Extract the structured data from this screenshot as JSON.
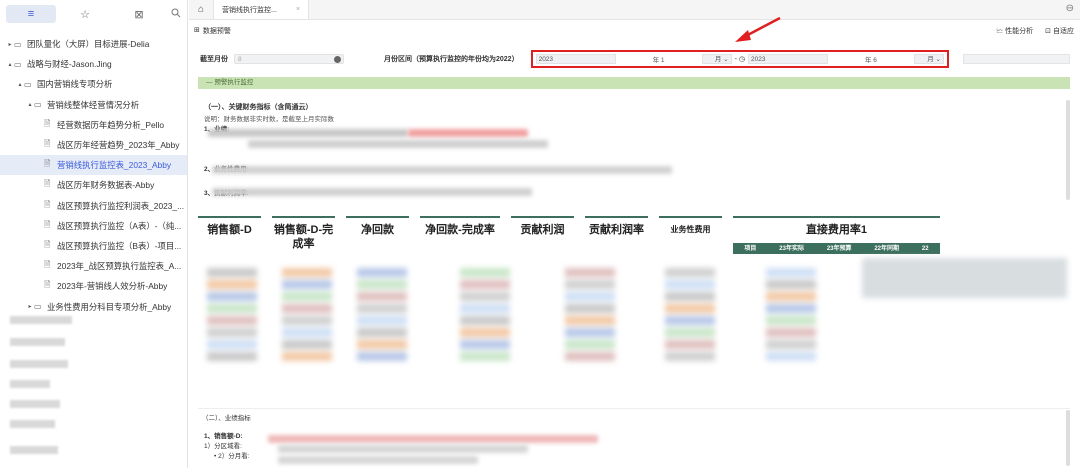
{
  "sidebar": {
    "tabs": [
      "≡",
      "☆",
      "⊠"
    ],
    "search_icon": "search-icon",
    "items": [
      {
        "label": "团队量化（大屏）目标进展-Delia",
        "level": 0,
        "caret": "▸",
        "type": "folder"
      },
      {
        "label": "战略与财经-Jason.Jing",
        "level": 0,
        "caret": "▴",
        "type": "folder"
      },
      {
        "label": "国内营销线专项分析",
        "level": 1,
        "caret": "▴",
        "type": "folder"
      },
      {
        "label": "营销线整体经营情况分析",
        "level": 2,
        "caret": "▴",
        "type": "folder"
      },
      {
        "label": "经营数据历年趋势分析_Pello",
        "level": 3,
        "caret": "",
        "type": "doc"
      },
      {
        "label": "战区历年经营趋势_2023年_Abby",
        "level": 3,
        "caret": "",
        "type": "doc"
      },
      {
        "label": "营销线执行监控表_2023_Abby",
        "level": 3,
        "caret": "",
        "type": "doc",
        "selected": true
      },
      {
        "label": "战区历年财务数据表-Abby",
        "level": 3,
        "caret": "",
        "type": "doc"
      },
      {
        "label": "战区预算执行监控利润表_2023_...",
        "level": 3,
        "caret": "",
        "type": "doc"
      },
      {
        "label": "战区预算执行监控（A表）-（纯...",
        "level": 3,
        "caret": "",
        "type": "doc"
      },
      {
        "label": "战区预算执行监控（B表）-项目...",
        "level": 3,
        "caret": "",
        "type": "doc"
      },
      {
        "label": "2023年_战区预算执行监控表_A...",
        "level": 3,
        "caret": "",
        "type": "doc"
      },
      {
        "label": "2023年-营销线人效分析-Abby",
        "level": 3,
        "caret": "",
        "type": "doc"
      },
      {
        "label": "业务性费用分科目专项分析_Abby",
        "level": 2,
        "caret": "▸",
        "type": "folder"
      }
    ]
  },
  "topbar": {
    "tab_title": "营销线执行监控...",
    "close": "×",
    "right_icon": "⊖"
  },
  "report": {
    "title": "数据预警",
    "actions": [
      {
        "icon": "🗠",
        "label": "性能分析"
      },
      {
        "icon": "⊡",
        "label": "自适应"
      }
    ]
  },
  "filters": {
    "as_of_label": "截至月份",
    "as_of_value": "8",
    "range_label": "月份区间（预算执行监控的年份均为2022）",
    "start_year": "2023",
    "start_unit_year": "年 1",
    "start_month_unit": "月",
    "separator": "- ◷",
    "end_year": "2023",
    "end_unit_year": "年 6",
    "end_month_unit": "月"
  },
  "section_title": "预警执行监控",
  "indicators": {
    "title": "（一）、关键财务指标（含简通云）",
    "note": "说明：财务数据非实时数，是截至上月实际数",
    "items": [
      "1、业绩:",
      "2、业务性费用:",
      "3、贡献利润率:"
    ]
  },
  "kpi_headers": [
    "销售额-D",
    "销售额-D-完成率",
    "净回款",
    "净回款-完成率",
    "贡献利润",
    "贡献利润率",
    "业务性费用",
    "直接费用率1"
  ],
  "mini_table_headers": [
    "项目",
    "23年实际",
    "23年预算",
    "22年同期",
    "22"
  ],
  "lower": {
    "title": "（二）、业绩指标",
    "item1": "1、销售额-D:",
    "sub1": "1）分区域看:",
    "sub2": "• 2）分月看:"
  },
  "colors": {
    "accent": "#3b5bdb",
    "header_green": "#3d6f5f",
    "section_green": "#c9e3b5",
    "highlight_red": "#e02020"
  }
}
